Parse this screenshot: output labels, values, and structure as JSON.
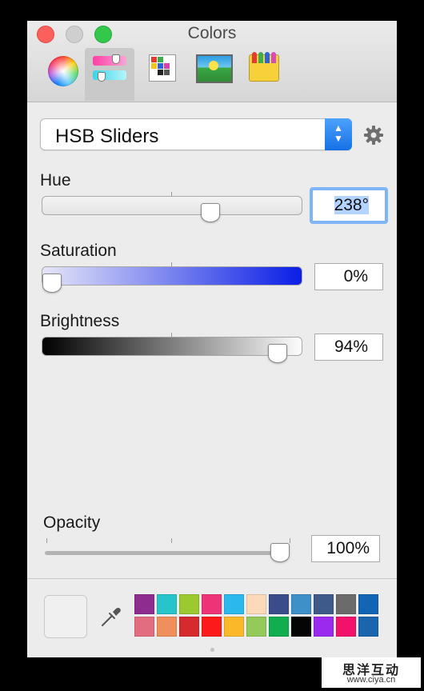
{
  "window": {
    "title": "Colors"
  },
  "toolbar": {
    "items": [
      {
        "name": "color-wheel"
      },
      {
        "name": "color-sliders",
        "selected": true
      },
      {
        "name": "color-palettes"
      },
      {
        "name": "image-palettes"
      },
      {
        "name": "crayons"
      }
    ]
  },
  "mode_popup": {
    "selected": "HSB Sliders"
  },
  "sliders": {
    "hue": {
      "label": "Hue",
      "value": "238°",
      "level": 0.66
    },
    "saturation": {
      "label": "Saturation",
      "value": "0%",
      "level": 0.0,
      "gradient_start": "#e6e6f8",
      "gradient_end": "#0a1ee6"
    },
    "brightness": {
      "label": "Brightness",
      "value": "94%",
      "level": 0.94
    }
  },
  "opacity": {
    "label": "Opacity",
    "value": "100%",
    "level": 1.0
  },
  "preview_color": "#f0f0f0",
  "swatches": [
    "#8e2c8f",
    "#27c4c9",
    "#9cc830",
    "#ee3477",
    "#2bb8ea",
    "#fcd9b8",
    "#3a4d8a",
    "#3e90c9",
    "#3d5a8a",
    "#6b6b6b",
    "#1264b4",
    "#e36d80",
    "#ef8f5b",
    "#d52a2e",
    "#fb1b1b",
    "#fbb829",
    "#93ca5a",
    "#11ad4e",
    "#050505",
    "#9a2bee",
    "#f2116b",
    "#1a65ae"
  ],
  "watermark": {
    "chinese": "思洋互动",
    "url": "www.ciya.cn"
  }
}
